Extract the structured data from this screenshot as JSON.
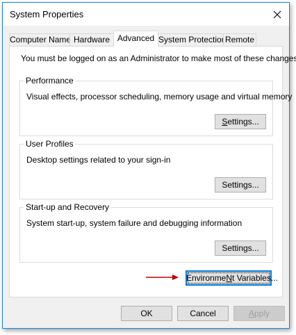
{
  "window": {
    "title": "System Properties",
    "close_icon": "close-icon"
  },
  "tabs": [
    {
      "label": "Computer Name",
      "active": false
    },
    {
      "label": "Hardware",
      "active": false
    },
    {
      "label": "Advanced",
      "active": true
    },
    {
      "label": "System Protection",
      "active": false
    },
    {
      "label": "Remote",
      "active": false
    }
  ],
  "advanced": {
    "admin_note": "You must be logged on as an Administrator to make most of these changes.",
    "performance": {
      "title": "Performance",
      "description": "Visual effects, processor scheduling, memory usage and virtual memory",
      "settings_label_u": "S",
      "settings_label_rest": "ettings..."
    },
    "user_profiles": {
      "title": "User Profiles",
      "description": "Desktop settings related to your sign-in",
      "settings_label_u": "S",
      "settings_label_rest": "ettings..."
    },
    "startup_recovery": {
      "title": "Start-up and Recovery",
      "description": "System start-up, system failure and debugging information",
      "settings_label_u": "S",
      "settings_label_rest": "ettings..."
    },
    "env_button_u": "N",
    "env_button_prefix": "Environme",
    "env_button_rest": "t Variables...",
    "arrow_color": "#c00000"
  },
  "footer": {
    "ok": "OK",
    "cancel": "Cancel",
    "apply_u": "A",
    "apply_rest": "pply"
  }
}
